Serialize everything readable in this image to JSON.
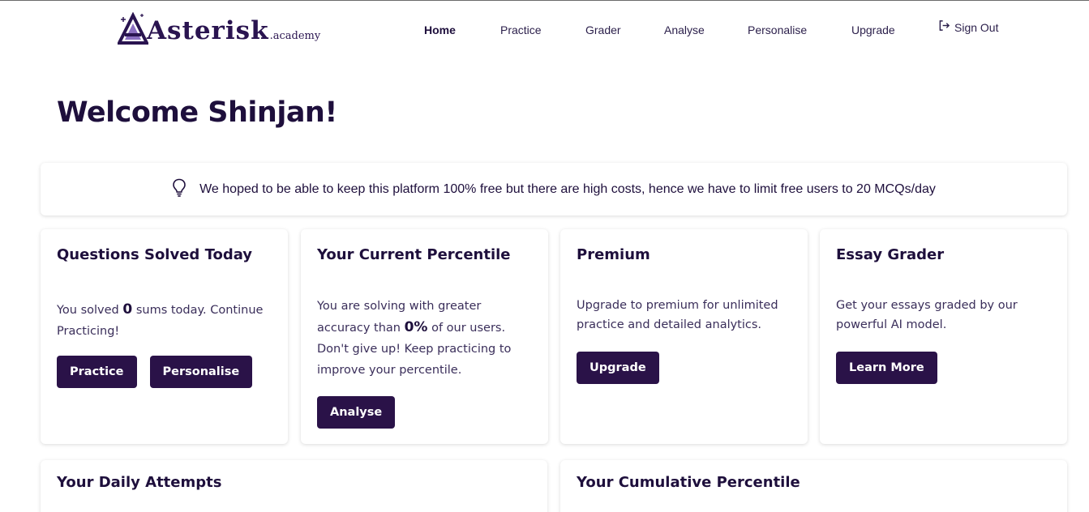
{
  "brand": {
    "logo_main": "Asterisk",
    "logo_sub": ".academy"
  },
  "nav": {
    "items": [
      "Home",
      "Practice",
      "Grader",
      "Analyse",
      "Personalise",
      "Upgrade"
    ],
    "signout": "Sign Out"
  },
  "welcome": "Welcome Shinjan!",
  "notice": "We hoped to be able to keep this platform 100% free but there are high costs, hence we have to limit free users to 20 MCQs/day",
  "cards": {
    "questions": {
      "title": "Questions Solved Today",
      "text_pre": "You solved ",
      "count": "0",
      "text_post": " sums today. Continue Practicing!",
      "btn_practice": "Practice",
      "btn_personalise": "Personalise"
    },
    "percentile": {
      "title": "Your Current Percentile",
      "text_pre": "You are solving with greater accuracy than ",
      "value": "0%",
      "text_post": " of our users. Don't give up! Keep practicing to improve your percentile.",
      "btn": "Analyse"
    },
    "premium": {
      "title": "Premium",
      "text": "Upgrade to premium for unlimited practice and detailed analytics.",
      "btn": "Upgrade"
    },
    "essay": {
      "title": "Essay Grader",
      "text": "Get your essays graded by our powerful AI model.",
      "btn": "Learn More"
    }
  },
  "lower": {
    "daily": "Your Daily Attempts",
    "cumulative": "Your Cumulative Percentile"
  },
  "icons": {
    "signout": "sign-out-icon",
    "notice": "lightbulb-icon",
    "logo": "asterisk-logo-icon"
  },
  "colors": {
    "primary": "#2a1248",
    "text": "#1e0f3c"
  }
}
